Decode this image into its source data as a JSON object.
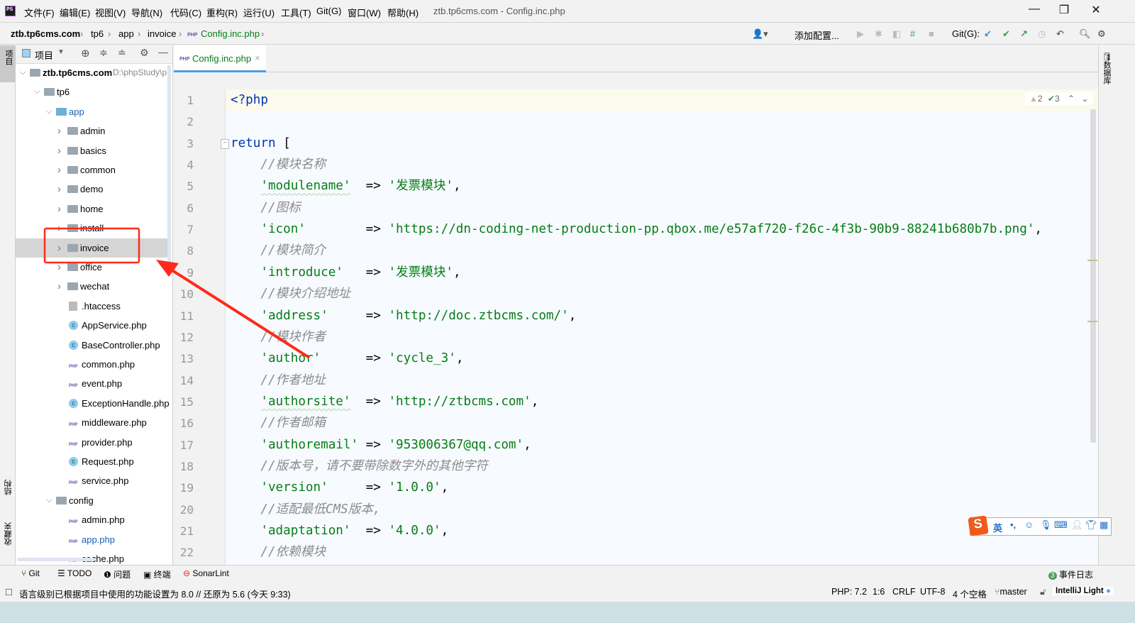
{
  "app": {
    "logo": "PS",
    "window_title": "ztb.tp6cms.com - Config.inc.php"
  },
  "menu": [
    "文件(F)",
    "编辑(E)",
    "视图(V)",
    "导航(N)",
    "代码(C)",
    "重构(R)",
    "运行(U)",
    "工具(T)",
    "Git(G)",
    "窗口(W)",
    "帮助(H)"
  ],
  "breadcrumb": [
    "ztb.tp6cms.com",
    "tp6",
    "app",
    "invoice",
    "Config.inc.php"
  ],
  "toolbar": {
    "add_config": "添加配置...",
    "git_label": "Git(G):"
  },
  "project": {
    "title": "项目",
    "left_tabs": [
      "项目",
      "结构",
      "收藏夹"
    ],
    "right_tab": "数据库",
    "root": {
      "name": "ztb.tp6cms.com",
      "path": "D:\\phpStudy\\p"
    },
    "tree": [
      {
        "label": "tp6",
        "type": "dir",
        "level": 1,
        "open": true
      },
      {
        "label": "app",
        "type": "dir",
        "level": 2,
        "open": true,
        "color": "blue"
      },
      {
        "label": "admin",
        "type": "dir",
        "level": 3
      },
      {
        "label": "basics",
        "type": "dir",
        "level": 3
      },
      {
        "label": "common",
        "type": "dir",
        "level": 3
      },
      {
        "label": "demo",
        "type": "dir",
        "level": 3
      },
      {
        "label": "home",
        "type": "dir",
        "level": 3
      },
      {
        "label": "install",
        "type": "dir",
        "level": 3
      },
      {
        "label": "invoice",
        "type": "dir",
        "level": 3,
        "selected": true
      },
      {
        "label": "office",
        "type": "dir",
        "level": 3
      },
      {
        "label": "wechat",
        "type": "dir",
        "level": 3
      },
      {
        "label": ".htaccess",
        "type": "ht",
        "level": 3
      },
      {
        "label": "AppService.php",
        "type": "cls",
        "level": 3
      },
      {
        "label": "BaseController.php",
        "type": "cls",
        "level": 3
      },
      {
        "label": "common.php",
        "type": "php",
        "level": 3
      },
      {
        "label": "event.php",
        "type": "php",
        "level": 3
      },
      {
        "label": "ExceptionHandle.php",
        "type": "cls",
        "level": 3
      },
      {
        "label": "middleware.php",
        "type": "php",
        "level": 3
      },
      {
        "label": "provider.php",
        "type": "php",
        "level": 3
      },
      {
        "label": "Request.php",
        "type": "cls",
        "level": 3
      },
      {
        "label": "service.php",
        "type": "php",
        "level": 3
      },
      {
        "label": "config",
        "type": "dir",
        "level": 2,
        "open": true
      },
      {
        "label": "admin.php",
        "type": "php",
        "level": 3
      },
      {
        "label": "app.php",
        "type": "php",
        "level": 3,
        "color": "blue"
      },
      {
        "label": "cache.php",
        "type": "php",
        "level": 3
      }
    ]
  },
  "editor": {
    "tab": "Config.inc.php",
    "warnings": "2",
    "weak_warnings": "3",
    "lines": [
      [
        [
          "kw",
          "<?php"
        ]
      ],
      [],
      [
        [
          "kw",
          "return"
        ],
        [
          "op",
          " ["
        ]
      ],
      [
        [
          "op",
          "    "
        ],
        [
          "cm",
          "//模块名称"
        ]
      ],
      [
        [
          "op",
          "    "
        ],
        [
          "key",
          "'modulename'"
        ],
        [
          "op",
          "  => "
        ],
        [
          "str",
          "'发票模块'"
        ],
        [
          "op",
          ","
        ]
      ],
      [
        [
          "op",
          "    "
        ],
        [
          "cm",
          "//图标"
        ]
      ],
      [
        [
          "op",
          "    "
        ],
        [
          "str",
          "'icon'"
        ],
        [
          "op",
          "        => "
        ],
        [
          "str",
          "'https://dn-coding-net-production-pp.qbox.me/e57af720-f26c-4f3b-90b9-88241b680b7b.png'"
        ],
        [
          "op",
          ","
        ]
      ],
      [
        [
          "op",
          "    "
        ],
        [
          "cm",
          "//模块简介"
        ]
      ],
      [
        [
          "op",
          "    "
        ],
        [
          "str",
          "'introduce'"
        ],
        [
          "op",
          "   => "
        ],
        [
          "str",
          "'发票模块'"
        ],
        [
          "op",
          ","
        ]
      ],
      [
        [
          "op",
          "    "
        ],
        [
          "cm",
          "//模块介绍地址"
        ]
      ],
      [
        [
          "op",
          "    "
        ],
        [
          "str",
          "'address'"
        ],
        [
          "op",
          "     => "
        ],
        [
          "str",
          "'http://doc.ztbcms.com/'"
        ],
        [
          "op",
          ","
        ]
      ],
      [
        [
          "op",
          "    "
        ],
        [
          "cm",
          "//模块作者"
        ]
      ],
      [
        [
          "op",
          "    "
        ],
        [
          "str",
          "'author'"
        ],
        [
          "op",
          "      => "
        ],
        [
          "str",
          "'cycle_3'"
        ],
        [
          "op",
          ","
        ]
      ],
      [
        [
          "op",
          "    "
        ],
        [
          "cm",
          "//作者地址"
        ]
      ],
      [
        [
          "op",
          "    "
        ],
        [
          "key",
          "'authorsite'"
        ],
        [
          "op",
          "  => "
        ],
        [
          "str",
          "'http://ztbcms.com'"
        ],
        [
          "op",
          ","
        ]
      ],
      [
        [
          "op",
          "    "
        ],
        [
          "cm",
          "//作者邮箱"
        ]
      ],
      [
        [
          "op",
          "    "
        ],
        [
          "str",
          "'authoremail'"
        ],
        [
          "op",
          " => "
        ],
        [
          "str",
          "'953006367@qq.com'"
        ],
        [
          "op",
          ","
        ]
      ],
      [
        [
          "op",
          "    "
        ],
        [
          "cm",
          "//版本号，请不要带除数字外的其他字符"
        ]
      ],
      [
        [
          "op",
          "    "
        ],
        [
          "str",
          "'version'"
        ],
        [
          "op",
          "     => "
        ],
        [
          "str",
          "'1.0.0'"
        ],
        [
          "op",
          ","
        ]
      ],
      [
        [
          "op",
          "    "
        ],
        [
          "cm",
          "//适配最低CMS版本,"
        ]
      ],
      [
        [
          "op",
          "    "
        ],
        [
          "str",
          "'adaptation'"
        ],
        [
          "op",
          "  => "
        ],
        [
          "str",
          "'4.0.0'"
        ],
        [
          "op",
          ","
        ]
      ],
      [
        [
          "op",
          "    "
        ],
        [
          "cm",
          "//依赖模块"
        ]
      ]
    ]
  },
  "toolwindows": [
    "Git",
    "TODO",
    "问题",
    "终端",
    "SonarLint"
  ],
  "event_log": {
    "count": "3",
    "label": "事件日志"
  },
  "ime": {
    "mode": "英"
  },
  "status": {
    "message": "语言级别已根据项目中使用的功能设置为 8.0 // 还原为 5.6 (今天 9:33)",
    "php": "PHP: 7.2",
    "pos": "1:6",
    "eol": "CRLF",
    "enc": "UTF-8",
    "indent": "4 个空格",
    "branch": "master",
    "theme": "IntelliJ Light"
  },
  "colors": {
    "accent": "#4a9de3",
    "annotation": "#ff2a1a",
    "string": "#067d17",
    "keyword": "#0033b3",
    "comment": "#8c8c8c"
  }
}
